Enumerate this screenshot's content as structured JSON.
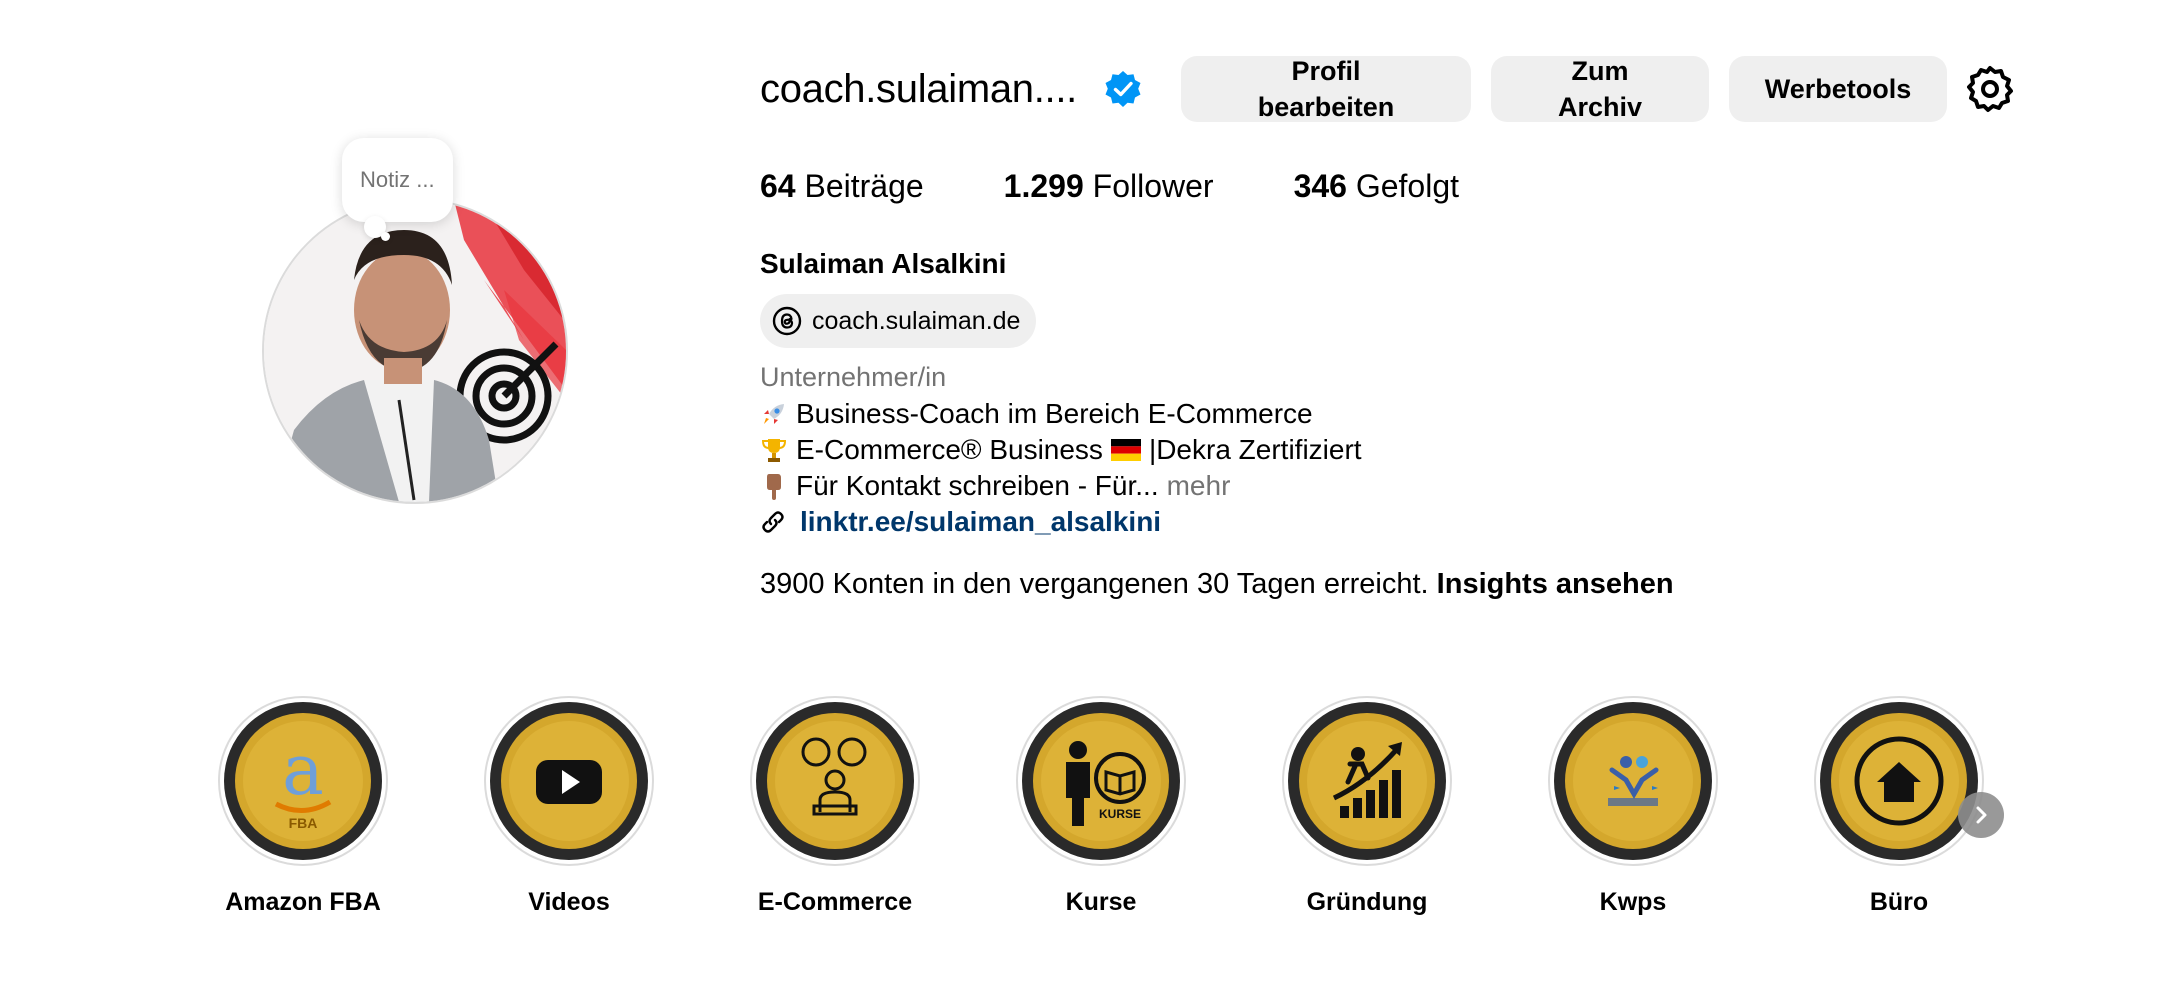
{
  "profile": {
    "username": "coach.sulaiman....",
    "note_placeholder": "Notiz ...",
    "buttons": {
      "edit_line1": "Profil",
      "edit_line2": "bearbeiten",
      "archive_line1": "Zum",
      "archive_line2": "Archiv",
      "tools": "Werbetools"
    },
    "stats": [
      {
        "value": "64",
        "label": "Beiträge"
      },
      {
        "value": "1.299",
        "label": "Follower"
      },
      {
        "value": "346",
        "label": "Gefolgt"
      }
    ],
    "full_name": "Sulaiman Alsalkini",
    "threads_handle": "coach.sulaiman.de",
    "category": "Unternehmer/in",
    "bio": [
      {
        "icon": "rocket-emoji",
        "text": "Business-Coach im Bereich E-Commerce"
      },
      {
        "icon": "trophy-emoji",
        "text_before": "E-Commerce® Business",
        "flag": "german-flag-emoji",
        "text_after": "|Dekra Zertifiziert"
      },
      {
        "icon": "pointing-down-emoji",
        "text": "Für Kontakt schreiben - Für...",
        "more": "mehr"
      }
    ],
    "link": "linktr.ee/sulaiman_alsalkini",
    "insights_text": "3900 Konten in den vergangenen 30 Tagen erreicht.",
    "insights_link": "Insights ansehen"
  },
  "highlights": [
    {
      "label": "Amazon FBA",
      "icon": "amazon-fba-icon"
    },
    {
      "label": "Videos",
      "icon": "youtube-play-icon"
    },
    {
      "label": "E-Commerce",
      "icon": "ecommerce-person-icon"
    },
    {
      "label": "Kurse",
      "icon": "kurse-book-icon"
    },
    {
      "label": "Gründung",
      "icon": "growth-chart-icon"
    },
    {
      "label": "Kwps",
      "icon": "kwps-logo-icon"
    },
    {
      "label": "Büro",
      "icon": "home-icon"
    }
  ],
  "colors": {
    "verified_blue": "#0095f6",
    "link_blue": "#00376b",
    "button_bg": "#efefef",
    "muted_text": "#737373",
    "highlight_gold": "#d4a72c"
  }
}
